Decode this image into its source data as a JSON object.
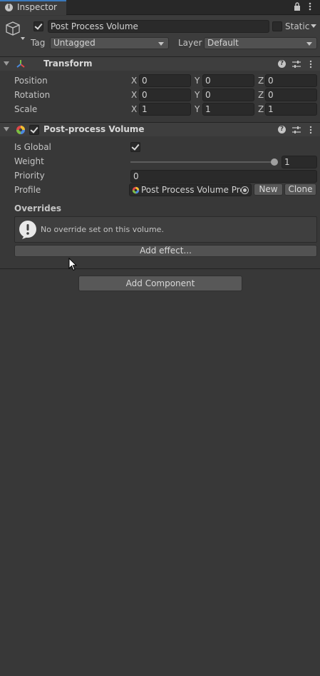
{
  "tab": {
    "title": "Inspector"
  },
  "gameobject": {
    "name": "Post Process Volume",
    "static_label": "Static",
    "tag_label": "Tag",
    "tag_value": "Untagged",
    "layer_label": "Layer",
    "layer_value": "Default"
  },
  "transform": {
    "title": "Transform",
    "rows": [
      {
        "label": "Position",
        "x": "0",
        "y": "0",
        "z": "0"
      },
      {
        "label": "Rotation",
        "x": "0",
        "y": "0",
        "z": "0"
      },
      {
        "label": "Scale",
        "x": "1",
        "y": "1",
        "z": "1"
      }
    ],
    "axis": {
      "x": "X",
      "y": "Y",
      "z": "Z"
    }
  },
  "volume": {
    "title": "Post-process Volume",
    "is_global_label": "Is Global",
    "weight_label": "Weight",
    "weight_value": "1",
    "priority_label": "Priority",
    "priority_value": "0",
    "profile_label": "Profile",
    "profile_value": "Post Process Volume Profile",
    "new_label": "New",
    "clone_label": "Clone",
    "overrides_label": "Overrides",
    "no_override_msg": "No override set on this volume.",
    "add_effect_label": "Add effect..."
  },
  "add_component_label": "Add Component",
  "colors": {
    "background": "#383838",
    "tab_accent": "#3a79bb"
  }
}
